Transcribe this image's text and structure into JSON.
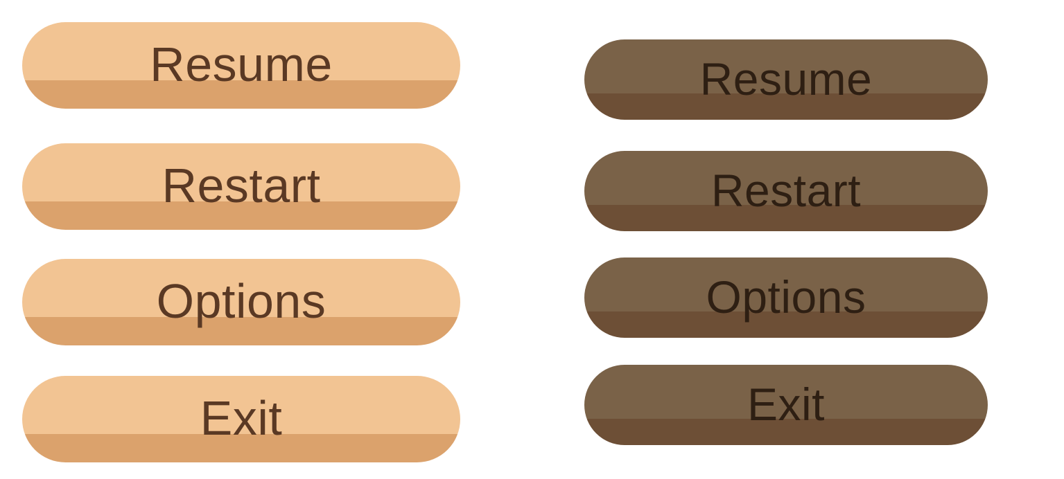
{
  "menus": {
    "light": {
      "colors": {
        "top": "#f2c493",
        "bottom": "#dba26c",
        "text": "#5a3924"
      },
      "buttons": [
        {
          "label": "Resume"
        },
        {
          "label": "Restart"
        },
        {
          "label": "Options"
        },
        {
          "label": "Exit"
        }
      ]
    },
    "dark": {
      "colors": {
        "top": "#7a6248",
        "bottom": "#6d4f36",
        "text": "#2e1f13"
      },
      "buttons": [
        {
          "label": "Resume"
        },
        {
          "label": "Restart"
        },
        {
          "label": "Options"
        },
        {
          "label": "Exit"
        }
      ]
    }
  }
}
